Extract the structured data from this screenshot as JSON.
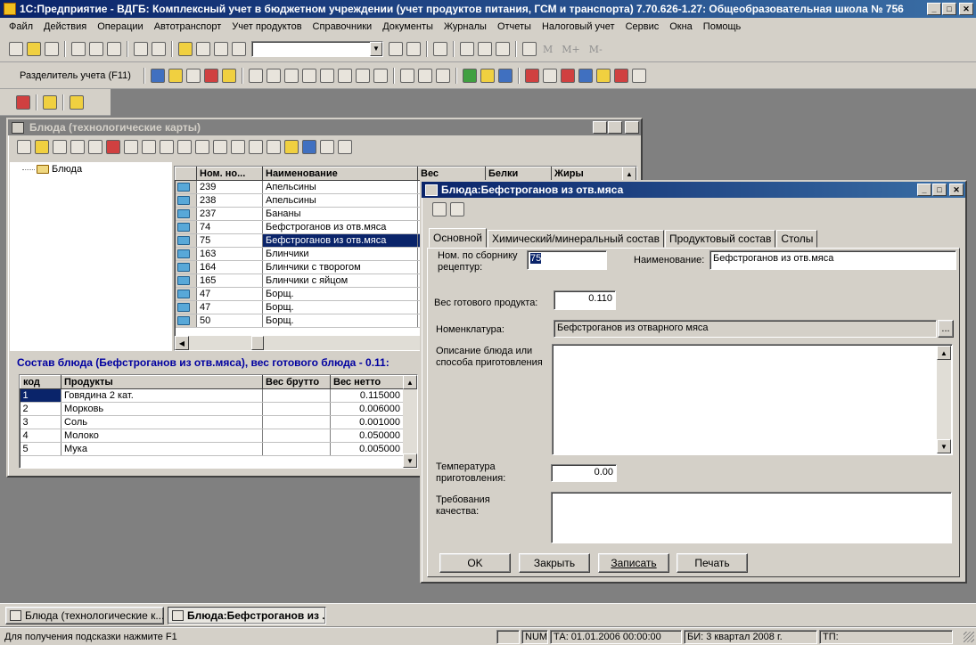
{
  "app": {
    "title": "1С:Предприятие - ВДГБ: Комплексный учет в бюджетном учреждении (учет продуктов питания, ГСМ и транспорта) 7.70.626-1.27: Общеобразовательная школа № 756"
  },
  "menu": [
    "Файл",
    "Действия",
    "Операции",
    "Автотранспорт",
    "Учет продуктов",
    "Справочники",
    "Документы",
    "Журналы",
    "Отчеты",
    "Налоговый учет",
    "Сервис",
    "Окна",
    "Помощь"
  ],
  "toolbar": {
    "separator_button": "Разделитель учета (F11)",
    "m_buttons": [
      "M",
      "M+",
      "M-"
    ]
  },
  "dishes_window": {
    "title": "Блюда (технологические карты)",
    "tree_item": "Блюда",
    "columns": [
      "Ном. но...",
      "Наименование",
      "Вес",
      "Белки",
      "Жиры"
    ],
    "rows": [
      {
        "num": "239",
        "name": "Апельсины"
      },
      {
        "num": "238",
        "name": "Апельсины"
      },
      {
        "num": "237",
        "name": "Бананы"
      },
      {
        "num": "74",
        "name": "Бефстроганов из отв.мяса"
      },
      {
        "num": "75",
        "name": "Бефстроганов из отв.мяса"
      },
      {
        "num": "163",
        "name": "Блинчики"
      },
      {
        "num": "164",
        "name": "Блинчики с творогом"
      },
      {
        "num": "165",
        "name": "Блинчики с яйцом"
      },
      {
        "num": "47",
        "name": "Борщ."
      },
      {
        "num": "47",
        "name": "Борщ."
      },
      {
        "num": "50",
        "name": "Борщ."
      }
    ],
    "composition_title": "Состав блюда (Бефстроганов из отв.мяса), вес готового блюда - 0.11:",
    "comp_columns": [
      "код",
      "Продукты",
      "Вес брутто",
      "Вес нетто"
    ],
    "comp_rows": [
      {
        "code": "1",
        "product": "Говядина 2 кат.",
        "gross": "",
        "net": "0.115000"
      },
      {
        "code": "2",
        "product": "Морковь",
        "gross": "",
        "net": "0.006000"
      },
      {
        "code": "3",
        "product": "Соль",
        "gross": "",
        "net": "0.001000"
      },
      {
        "code": "4",
        "product": "Молоко",
        "gross": "",
        "net": "0.050000"
      },
      {
        "code": "5",
        "product": "Мука",
        "gross": "",
        "net": "0.005000"
      }
    ]
  },
  "dish_form": {
    "title": "Блюда:Бефстроганов из отв.мяса",
    "tabs": [
      "Основной",
      "Химический/минеральный состав",
      "Продуктовый состав",
      "Столы"
    ],
    "num_label": "Ном. по сборнику рецептур:",
    "num_value": "75",
    "name_label": "Наименование:",
    "name_value": "Бефстроганов из отв.мяса",
    "weight_label": "Вес готового продукта:",
    "weight_value": "0.110",
    "nomen_label": "Номенклатура:",
    "nomen_value": "Бефстроганов из отварного мяса",
    "nomen_btn": "...",
    "desc_label": "Описание блюда или способа приготовления",
    "desc_value": "",
    "temp_label": "Температура приготовления:",
    "temp_value": "0.00",
    "quality_label": "Требования качества:",
    "quality_value": "",
    "buttons": {
      "ok": "OK",
      "close": "Закрыть",
      "save": "Записать",
      "print": "Печать"
    }
  },
  "taskbar": [
    "Блюда (технологические к...",
    "Блюда:Бефстроганов из ..."
  ],
  "status": {
    "hint": "Для получения подсказки нажмите F1",
    "num": "NUM",
    "ta": "ТА: 01.01.2006  00:00:00",
    "bi": "БИ: 3 квартал 2008 г.",
    "tp": "ТП:"
  }
}
